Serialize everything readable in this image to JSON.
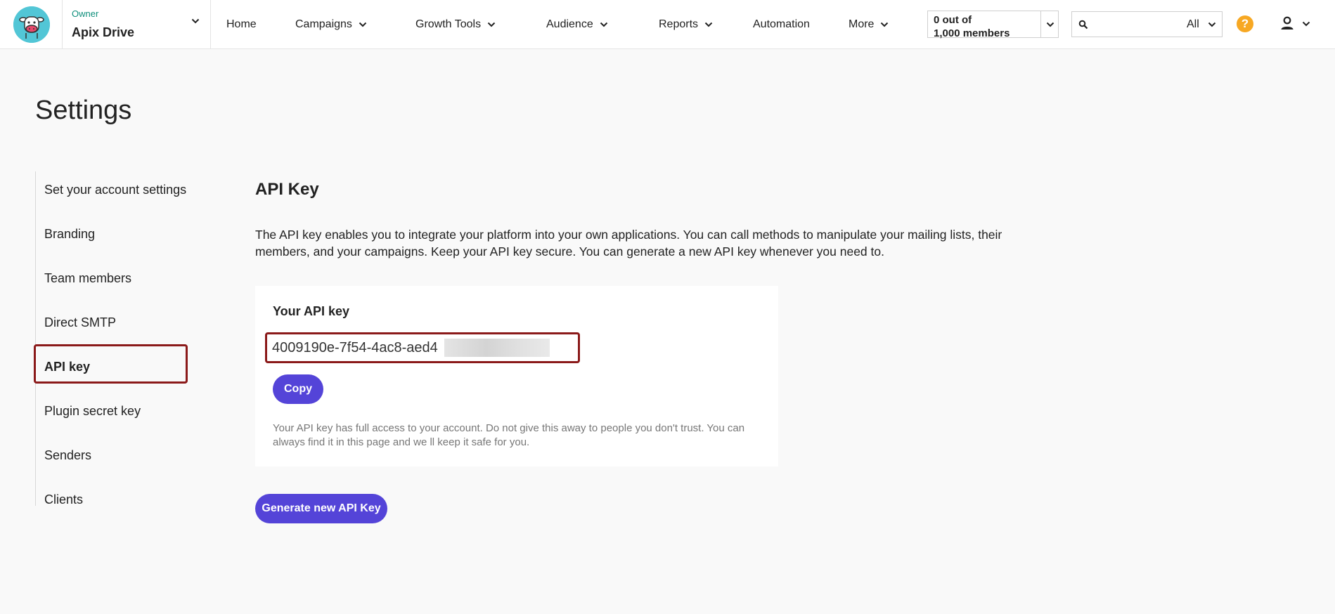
{
  "header": {
    "account_role": "Owner",
    "account_name": "Apix Drive",
    "nav": [
      {
        "label": "Home",
        "has_dropdown": false
      },
      {
        "label": "Campaigns",
        "has_dropdown": true
      },
      {
        "label": "Growth Tools",
        "has_dropdown": true
      },
      {
        "label": "Audience",
        "has_dropdown": true
      },
      {
        "label": "Reports",
        "has_dropdown": true
      },
      {
        "label": "Automation",
        "has_dropdown": false
      },
      {
        "label": "More",
        "has_dropdown": true
      }
    ],
    "members_line1": "0 out of",
    "members_line2": "1,000 members",
    "search_placeholder": "",
    "search_scope": "All",
    "help_glyph": "?"
  },
  "page": {
    "title": "Settings"
  },
  "sidebar": {
    "items": [
      {
        "label": "Set your account settings",
        "active": false
      },
      {
        "label": "Branding",
        "active": false
      },
      {
        "label": "Team members",
        "active": false
      },
      {
        "label": "Direct SMTP",
        "active": false
      },
      {
        "label": "API key",
        "active": true
      },
      {
        "label": "Plugin secret key",
        "active": false
      },
      {
        "label": "Senders",
        "active": false
      },
      {
        "label": "Clients",
        "active": false
      }
    ]
  },
  "api": {
    "section_title": "API Key",
    "description": "The API key enables you to integrate your platform into your own applications. You can call methods to manipulate your mailing lists, their members, and your campaigns. Keep your API key secure. You can generate a new API key whenever you need to.",
    "card_label": "Your API key",
    "key_value": "4009190e-7f54-4ac8-aed4",
    "copy_label": "Copy",
    "note": "Your API key has full access to your account. Do not give this away to people you don't trust. You can always find it in this page and we ll keep it safe for you.",
    "generate_label": "Generate new API Key"
  },
  "colors": {
    "accent": "#5444d8",
    "highlight_border": "#8b1a1a",
    "logo_bg": "#52c6d6",
    "owner_text": "#0f8f7c",
    "help": "#f7a823"
  },
  "icons": [
    "logo-cow-icon",
    "chevron-down-icon",
    "search-icon",
    "help-icon",
    "user-icon"
  ]
}
